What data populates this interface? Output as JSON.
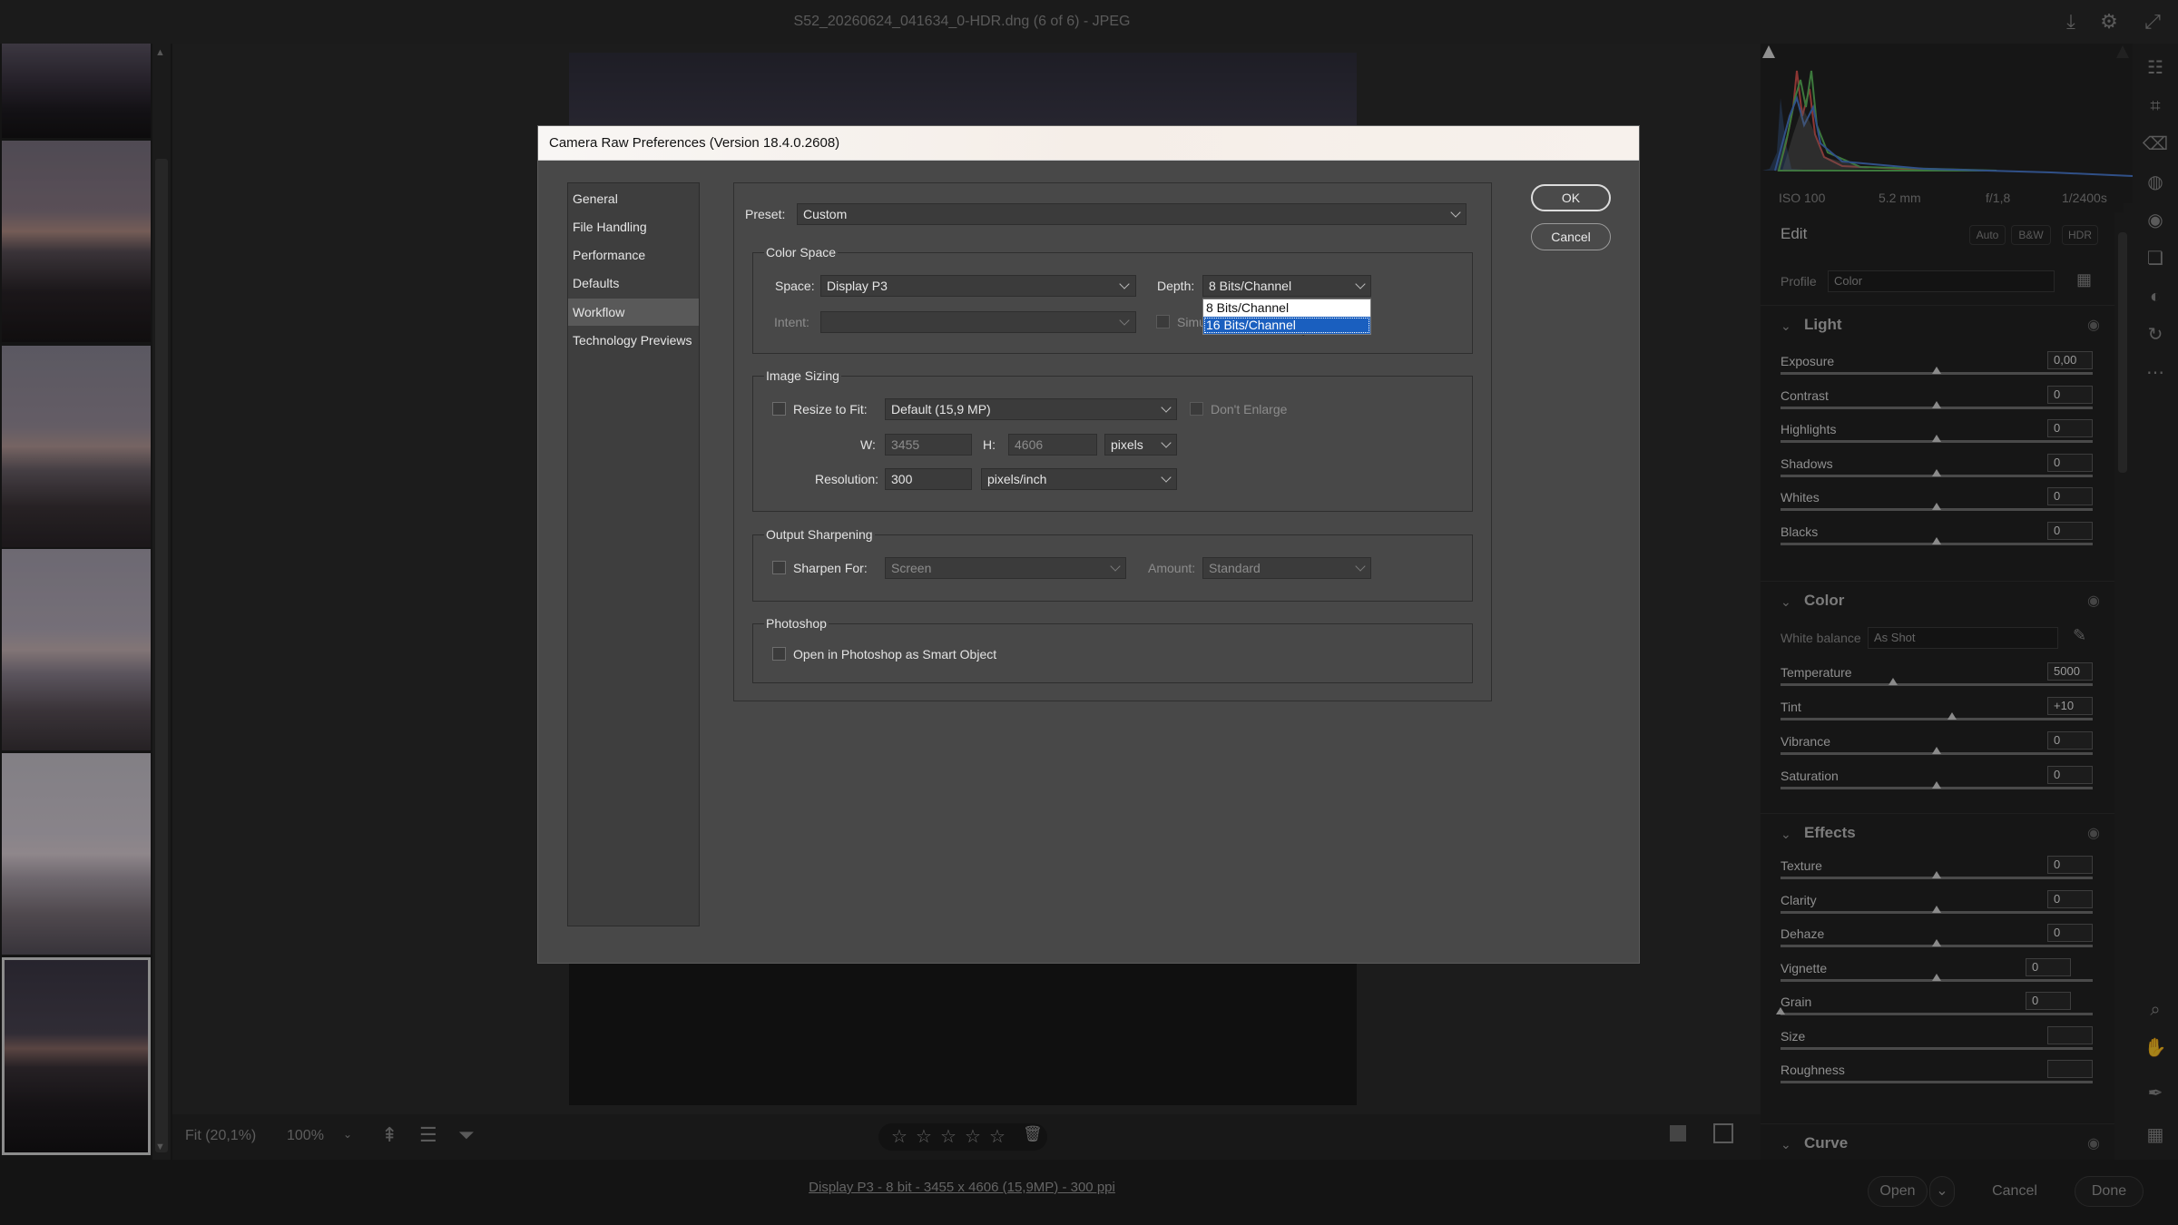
{
  "app": {
    "title": "S52_20260624_041634_0-HDR.dng (6 of 6) - JPEG",
    "icons": [
      "save-icon",
      "gear-icon",
      "expand-icon"
    ]
  },
  "filmstrip": {
    "thumbnails": [
      "photo-1",
      "photo-2",
      "photo-3",
      "photo-4",
      "photo-5",
      "photo-6"
    ],
    "selected_index": 5
  },
  "bottom_toolbar": {
    "fit_label": "Fit (20,1%)",
    "zoom_label": "100%",
    "rating_stars": 5
  },
  "status": {
    "workflow_link": "Display P3 - 8 bit - 3455 x 4606 (15,9MP) - 300 ppi",
    "open_label": "Open",
    "cancel_label": "Cancel",
    "done_label": "Done"
  },
  "histogram": {
    "iso": "ISO 100",
    "focal": "5.2 mm",
    "aperture": "f/1,8",
    "shutter": "1/2400s"
  },
  "edit_panel": {
    "title": "Edit",
    "auto_label": "Auto",
    "bw_label": "B&W",
    "hdr_label": "HDR",
    "profile_label": "Profile",
    "profile_value": "Color",
    "light": {
      "title": "Light",
      "sliders": [
        {
          "label": "Exposure",
          "value": "0,00",
          "pos": 0.5
        },
        {
          "label": "Contrast",
          "value": "0",
          "pos": 0.5
        },
        {
          "label": "Highlights",
          "value": "0",
          "pos": 0.5
        },
        {
          "label": "Shadows",
          "value": "0",
          "pos": 0.5
        },
        {
          "label": "Whites",
          "value": "0",
          "pos": 0.5
        },
        {
          "label": "Blacks",
          "value": "0",
          "pos": 0.5
        }
      ]
    },
    "color": {
      "title": "Color",
      "wb_label": "White balance",
      "wb_value": "As Shot",
      "sliders": [
        {
          "label": "Temperature",
          "value": "5000",
          "pos": 0.36
        },
        {
          "label": "Tint",
          "value": "+10",
          "pos": 0.55
        },
        {
          "label": "Vibrance",
          "value": "0",
          "pos": 0.5
        },
        {
          "label": "Saturation",
          "value": "0",
          "pos": 0.5
        }
      ]
    },
    "effects": {
      "title": "Effects",
      "sliders": [
        {
          "label": "Texture",
          "value": "0",
          "pos": 0.5
        },
        {
          "label": "Clarity",
          "value": "0",
          "pos": 0.5
        },
        {
          "label": "Dehaze",
          "value": "0",
          "pos": 0.5
        },
        {
          "label": "Vignette",
          "value": "0",
          "pos": 0.5
        },
        {
          "label": "Grain",
          "value": "0",
          "pos": 0.0
        },
        {
          "label": "Size",
          "value": "",
          "pos": null
        },
        {
          "label": "Roughness",
          "value": "",
          "pos": null
        }
      ]
    },
    "curve": {
      "title": "Curve"
    }
  },
  "dialog": {
    "title": "Camera Raw Preferences  (Version 18.4.0.2608)",
    "nav": [
      "General",
      "File Handling",
      "Performance",
      "Defaults",
      "Workflow",
      "Technology Previews"
    ],
    "nav_selected": 4,
    "ok_label": "OK",
    "cancel_label": "Cancel",
    "preset_label": "Preset:",
    "preset_value": "Custom",
    "color_space": {
      "title": "Color Space",
      "space_label": "Space:",
      "space_value": "Display P3",
      "depth_label": "Depth:",
      "depth_value": "8 Bits/Channel",
      "depth_options": [
        "8 Bits/Channel",
        "16 Bits/Channel"
      ],
      "depth_highlighted": 1,
      "intent_label": "Intent:",
      "intent_value": "",
      "simulate_label": "Simu"
    },
    "image_sizing": {
      "title": "Image Sizing",
      "resize_label": "Resize to Fit:",
      "resize_value": "Default  (15,9 MP)",
      "dont_enlarge_label": "Don't Enlarge",
      "w_label": "W:",
      "w_value": "3455",
      "h_label": "H:",
      "h_value": "4606",
      "unit_value": "pixels",
      "resolution_label": "Resolution:",
      "resolution_value": "300",
      "resolution_unit": "pixels/inch"
    },
    "output_sharpening": {
      "title": "Output Sharpening",
      "sharpen_label": "Sharpen For:",
      "sharpen_value": "Screen",
      "amount_label": "Amount:",
      "amount_value": "Standard"
    },
    "photoshop": {
      "title": "Photoshop",
      "smart_object_label": "Open in Photoshop as Smart Object"
    }
  }
}
